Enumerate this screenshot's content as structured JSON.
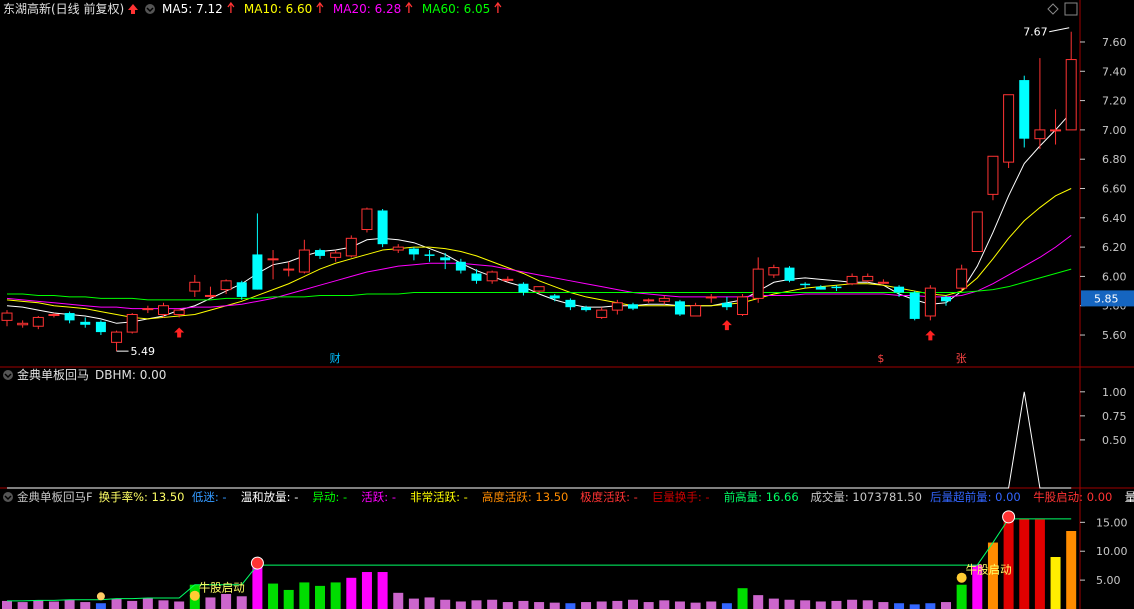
{
  "colors": {
    "up": "#ff3333",
    "down": "#00ffff",
    "ma5": "#ffffff",
    "ma10": "#ffff00",
    "ma20": "#ff00ff",
    "ma60": "#00ff00",
    "axis": "#c8c8c8",
    "panel_border": "#a00000",
    "price_box": "#1565c0"
  },
  "main_panel": {
    "title": "东湖高新(日线 前复权)",
    "ma_items": [
      {
        "label": "MA5: 7.12",
        "color": "#ffffff"
      },
      {
        "label": "MA10: 6.60",
        "color": "#ffff00"
      },
      {
        "label": "MA20: 6.28",
        "color": "#ff00ff"
      },
      {
        "label": "MA60: 6.05",
        "color": "#00ff00"
      }
    ],
    "y_ticks": [
      "7.60",
      "7.40",
      "7.20",
      "7.00",
      "6.80",
      "6.60",
      "6.40",
      "6.20",
      "6.00",
      "5.80",
      "5.60"
    ],
    "current_price": "5.85",
    "high_label": "7.67",
    "low_label": "5.49",
    "markers": [
      {
        "text": "财",
        "color": "#00bfff"
      },
      {
        "text": "$",
        "color": "#ff4444"
      },
      {
        "text": "张",
        "color": "#ff4444"
      }
    ]
  },
  "indicator_panel": {
    "title": "金典单板回马",
    "value_label": "DBHM: 0.00",
    "y_ticks": [
      "1.00",
      "0.75",
      "0.50"
    ]
  },
  "volume_panel": {
    "legend": [
      {
        "label": "金典单板回马F",
        "color": "#c8c8c8"
      },
      {
        "label": "换手率%: 13.50",
        "color": "#ffff66"
      },
      {
        "label": "低迷: -",
        "color": "#3399ff"
      },
      {
        "label": "温和放量: -",
        "color": "#ffffff"
      },
      {
        "label": "异动: -",
        "color": "#00ff00"
      },
      {
        "label": "活跃: -",
        "color": "#ff00ff"
      },
      {
        "label": "非常活跃: -",
        "color": "#ffff00"
      },
      {
        "label": "高度活跃: 13.50",
        "color": "#ff8c00"
      },
      {
        "label": "极度活跃: -",
        "color": "#ff3333"
      },
      {
        "label": "巨量换手: -",
        "color": "#cc0000"
      },
      {
        "label": "前高量: 16.66",
        "color": "#00ff66"
      },
      {
        "label": "成交量: 1073781.50",
        "color": "#c8c8c8"
      },
      {
        "label": "后量超前量: 0.00",
        "color": "#3366ff"
      },
      {
        "label": "牛股启动: 0.00",
        "color": "#ff3333"
      },
      {
        "label": "量比:",
        "color": "#ffffff"
      }
    ],
    "annotations": [
      "牛股启动",
      "牛股启动"
    ],
    "y_ticks": [
      "15.00",
      "10.00",
      "5.00"
    ]
  },
  "chart_data": {
    "type": "candlestick",
    "candles": [
      [
        5.7,
        5.75,
        5.77,
        5.66
      ],
      [
        5.67,
        5.68,
        5.7,
        5.65
      ],
      [
        5.66,
        5.72,
        5.73,
        5.64
      ],
      [
        5.74,
        5.74,
        5.75,
        5.72
      ],
      [
        5.75,
        5.7,
        5.76,
        5.68
      ],
      [
        5.69,
        5.67,
        5.72,
        5.65
      ],
      [
        5.69,
        5.62,
        5.7,
        5.6
      ],
      [
        5.55,
        5.62,
        5.63,
        5.49
      ],
      [
        5.62,
        5.74,
        5.75,
        5.61
      ],
      [
        5.78,
        5.78,
        5.8,
        5.75
      ],
      [
        5.74,
        5.8,
        5.82,
        5.72
      ],
      [
        5.74,
        5.77,
        5.77,
        5.72
      ],
      [
        5.9,
        5.96,
        6.01,
        5.86
      ],
      [
        5.87,
        5.87,
        5.93,
        5.85
      ],
      [
        5.91,
        5.97,
        5.98,
        5.88
      ],
      [
        5.96,
        5.86,
        5.97,
        5.84
      ],
      [
        6.15,
        5.91,
        6.43,
        5.91
      ],
      [
        6.12,
        6.12,
        6.18,
        5.98
      ],
      [
        6.05,
        6.05,
        6.1,
        6.0
      ],
      [
        6.03,
        6.18,
        6.25,
        6.02
      ],
      [
        6.18,
        6.14,
        6.19,
        6.12
      ],
      [
        6.13,
        6.16,
        6.18,
        6.1
      ],
      [
        6.14,
        6.26,
        6.28,
        6.13
      ],
      [
        6.32,
        6.46,
        6.47,
        6.3
      ],
      [
        6.45,
        6.22,
        6.46,
        6.2
      ],
      [
        6.18,
        6.2,
        6.22,
        6.16
      ],
      [
        6.19,
        6.15,
        6.2,
        6.11
      ],
      [
        6.15,
        6.14,
        6.18,
        6.1
      ],
      [
        6.13,
        6.11,
        6.16,
        6.05
      ],
      [
        6.1,
        6.04,
        6.12,
        6.02
      ],
      [
        6.02,
        5.97,
        6.05,
        5.95
      ],
      [
        5.97,
        6.03,
        6.04,
        5.95
      ],
      [
        5.98,
        5.98,
        6.0,
        5.96
      ],
      [
        5.95,
        5.89,
        5.96,
        5.87
      ],
      [
        5.9,
        5.93,
        5.92,
        5.88
      ],
      [
        5.87,
        5.85,
        5.88,
        5.83
      ],
      [
        5.84,
        5.79,
        5.85,
        5.77
      ],
      [
        5.79,
        5.77,
        5.8,
        5.76
      ],
      [
        5.72,
        5.77,
        5.79,
        5.71
      ],
      [
        5.77,
        5.82,
        5.84,
        5.74
      ],
      [
        5.81,
        5.78,
        5.82,
        5.77
      ],
      [
        5.84,
        5.84,
        5.85,
        5.82
      ],
      [
        5.83,
        5.85,
        5.87,
        5.81
      ],
      [
        5.83,
        5.74,
        5.84,
        5.73
      ],
      [
        5.73,
        5.8,
        5.82,
        5.73
      ],
      [
        5.86,
        5.86,
        5.88,
        5.82
      ],
      [
        5.82,
        5.79,
        5.86,
        5.77
      ],
      [
        5.74,
        5.86,
        5.88,
        5.73
      ],
      [
        5.85,
        6.05,
        6.13,
        5.82
      ],
      [
        6.01,
        6.06,
        6.08,
        5.99
      ],
      [
        6.06,
        5.97,
        6.07,
        5.96
      ],
      [
        5.95,
        5.94,
        5.96,
        5.92
      ],
      [
        5.93,
        5.91,
        5.94,
        5.91
      ],
      [
        5.93,
        5.92,
        5.94,
        5.9
      ],
      [
        5.95,
        6.0,
        6.02,
        5.94
      ],
      [
        5.97,
        6.0,
        6.02,
        5.96
      ],
      [
        5.96,
        5.96,
        5.98,
        5.95
      ],
      [
        5.93,
        5.89,
        5.94,
        5.86
      ],
      [
        5.89,
        5.71,
        5.9,
        5.7
      ],
      [
        5.73,
        5.92,
        5.94,
        5.7
      ],
      [
        5.86,
        5.83,
        5.87,
        5.8
      ],
      [
        5.92,
        6.05,
        6.08,
        5.9
      ],
      [
        6.17,
        6.44,
        6.44,
        6.17
      ],
      [
        6.56,
        6.82,
        6.82,
        6.52
      ],
      [
        6.78,
        7.24,
        7.24,
        6.74
      ],
      [
        7.34,
        6.94,
        7.37,
        6.88
      ],
      [
        6.94,
        7.0,
        7.49,
        6.87
      ],
      [
        7.0,
        7.0,
        7.14,
        6.9
      ],
      [
        7.0,
        7.48,
        7.67,
        7.0
      ]
    ],
    "ma": {
      "MA5": [
        5.8,
        5.79,
        5.77,
        5.75,
        5.74,
        5.73,
        5.71,
        5.68,
        5.69,
        5.71,
        5.73,
        5.77,
        5.8,
        5.85,
        5.9,
        5.95,
        6.02,
        6.08,
        6.1,
        6.14,
        6.17,
        6.18,
        6.2,
        6.25,
        6.26,
        6.25,
        6.23,
        6.19,
        6.15,
        6.09,
        6.04,
        6.0,
        5.96,
        5.93,
        5.88,
        5.84,
        5.81,
        5.79,
        5.79,
        5.8,
        5.8,
        5.81,
        5.81,
        5.8,
        5.8,
        5.8,
        5.82,
        5.84,
        5.9,
        5.96,
        5.98,
        5.99,
        5.98,
        5.97,
        5.96,
        5.96,
        5.94,
        5.88,
        5.84,
        5.81,
        5.82,
        5.9,
        6.07,
        6.3,
        6.55,
        6.77,
        6.89,
        7.0,
        7.12
      ],
      "MA10": [
        5.84,
        5.83,
        5.82,
        5.8,
        5.79,
        5.78,
        5.76,
        5.74,
        5.72,
        5.71,
        5.72,
        5.73,
        5.74,
        5.77,
        5.8,
        5.83,
        5.87,
        5.91,
        5.95,
        6.0,
        6.05,
        6.09,
        6.12,
        6.15,
        6.18,
        6.19,
        6.2,
        6.2,
        6.19,
        6.17,
        6.14,
        6.1,
        6.06,
        6.02,
        5.97,
        5.93,
        5.89,
        5.86,
        5.84,
        5.82,
        5.8,
        5.8,
        5.8,
        5.8,
        5.8,
        5.8,
        5.81,
        5.82,
        5.85,
        5.88,
        5.9,
        5.92,
        5.93,
        5.94,
        5.95,
        5.95,
        5.94,
        5.92,
        5.9,
        5.88,
        5.87,
        5.9,
        5.99,
        6.12,
        6.26,
        6.38,
        6.47,
        6.55,
        6.6
      ],
      "MA20": [
        5.85,
        5.84,
        5.83,
        5.82,
        5.81,
        5.8,
        5.79,
        5.79,
        5.78,
        5.78,
        5.78,
        5.78,
        5.79,
        5.79,
        5.8,
        5.81,
        5.83,
        5.85,
        5.88,
        5.91,
        5.94,
        5.97,
        6.0,
        6.03,
        6.05,
        6.07,
        6.08,
        6.09,
        6.09,
        6.09,
        6.08,
        6.07,
        6.05,
        6.03,
        6.01,
        5.99,
        5.97,
        5.95,
        5.93,
        5.91,
        5.89,
        5.88,
        5.87,
        5.86,
        5.86,
        5.86,
        5.86,
        5.86,
        5.87,
        5.87,
        5.87,
        5.88,
        5.88,
        5.88,
        5.88,
        5.88,
        5.88,
        5.87,
        5.87,
        5.86,
        5.86,
        5.87,
        5.9,
        5.95,
        6.01,
        6.07,
        6.13,
        6.2,
        6.28
      ],
      "MA60": [
        5.88,
        5.88,
        5.87,
        5.87,
        5.86,
        5.86,
        5.85,
        5.85,
        5.85,
        5.84,
        5.84,
        5.84,
        5.84,
        5.84,
        5.85,
        5.85,
        5.85,
        5.86,
        5.86,
        5.86,
        5.87,
        5.87,
        5.87,
        5.88,
        5.88,
        5.88,
        5.89,
        5.89,
        5.89,
        5.89,
        5.89,
        5.89,
        5.89,
        5.89,
        5.89,
        5.89,
        5.89,
        5.89,
        5.89,
        5.89,
        5.89,
        5.89,
        5.89,
        5.89,
        5.89,
        5.89,
        5.89,
        5.89,
        5.89,
        5.89,
        5.89,
        5.89,
        5.89,
        5.89,
        5.89,
        5.89,
        5.89,
        5.89,
        5.89,
        5.89,
        5.89,
        5.89,
        5.9,
        5.91,
        5.93,
        5.96,
        5.99,
        6.02,
        6.05
      ]
    },
    "ylim": [
      5.45,
      7.75
    ],
    "turnover": [
      1.4,
      1.2,
      1.5,
      1.3,
      1.6,
      1.2,
      1.0,
      1.8,
      1.4,
      1.9,
      1.5,
      1.3,
      4.2,
      2.0,
      2.6,
      2.2,
      7.6,
      4.4,
      3.3,
      4.6,
      4.0,
      4.6,
      5.4,
      6.4,
      6.4,
      2.8,
      1.8,
      2.0,
      1.6,
      1.3,
      1.5,
      1.6,
      1.2,
      1.4,
      1.2,
      1.1,
      1.0,
      1.2,
      1.3,
      1.4,
      1.6,
      1.2,
      1.5,
      1.3,
      1.1,
      1.3,
      1.0,
      3.6,
      2.4,
      1.8,
      1.6,
      1.5,
      1.3,
      1.4,
      1.6,
      1.5,
      1.2,
      1.0,
      0.8,
      1.0,
      1.2,
      4.2,
      7.6,
      11.5,
      15.6,
      15.6,
      15.5,
      9.0,
      13.5
    ],
    "volume_ylim": [
      0,
      18
    ],
    "dbhm_peak_index": 65
  }
}
